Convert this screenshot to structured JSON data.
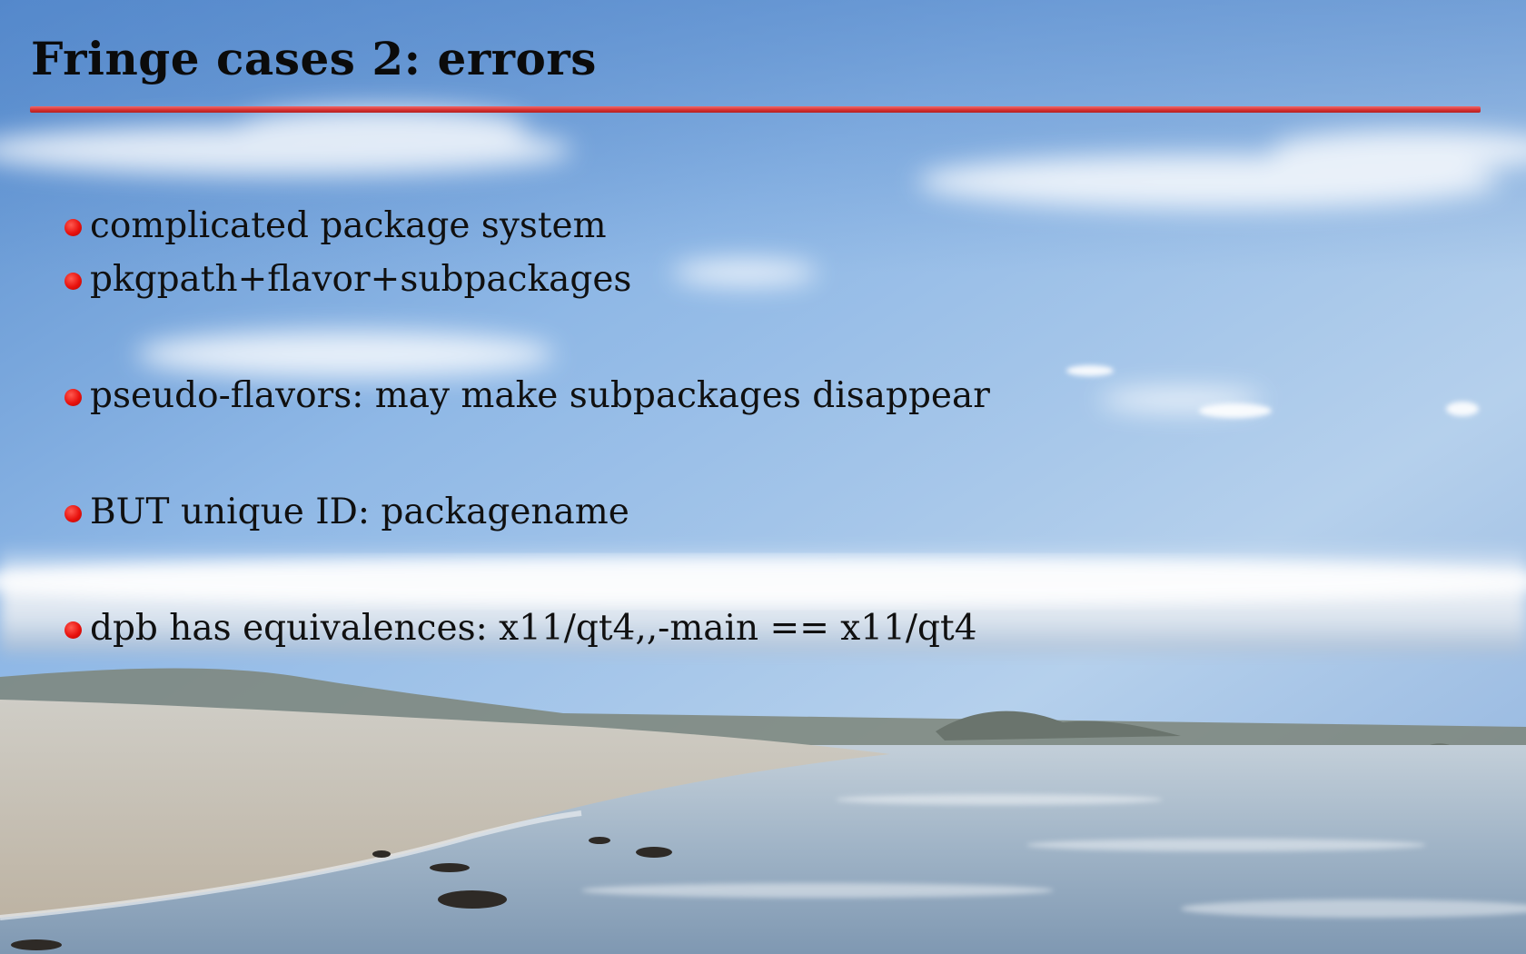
{
  "slide": {
    "title": "Fringe cases 2: errors",
    "bullets": [
      "complicated package system",
      "pkgpath+flavor+subpackages",
      "pseudo-flavors: may make subpackages disappear",
      "BUT unique ID: packagename",
      "dpb has equivalences: x11/qt4,,-main == x11/qt4"
    ],
    "colors": {
      "accent_rule": "#d63232",
      "bullet_dot": "#e8120e",
      "text": "#101010",
      "sky": "#6f9fd8"
    }
  }
}
